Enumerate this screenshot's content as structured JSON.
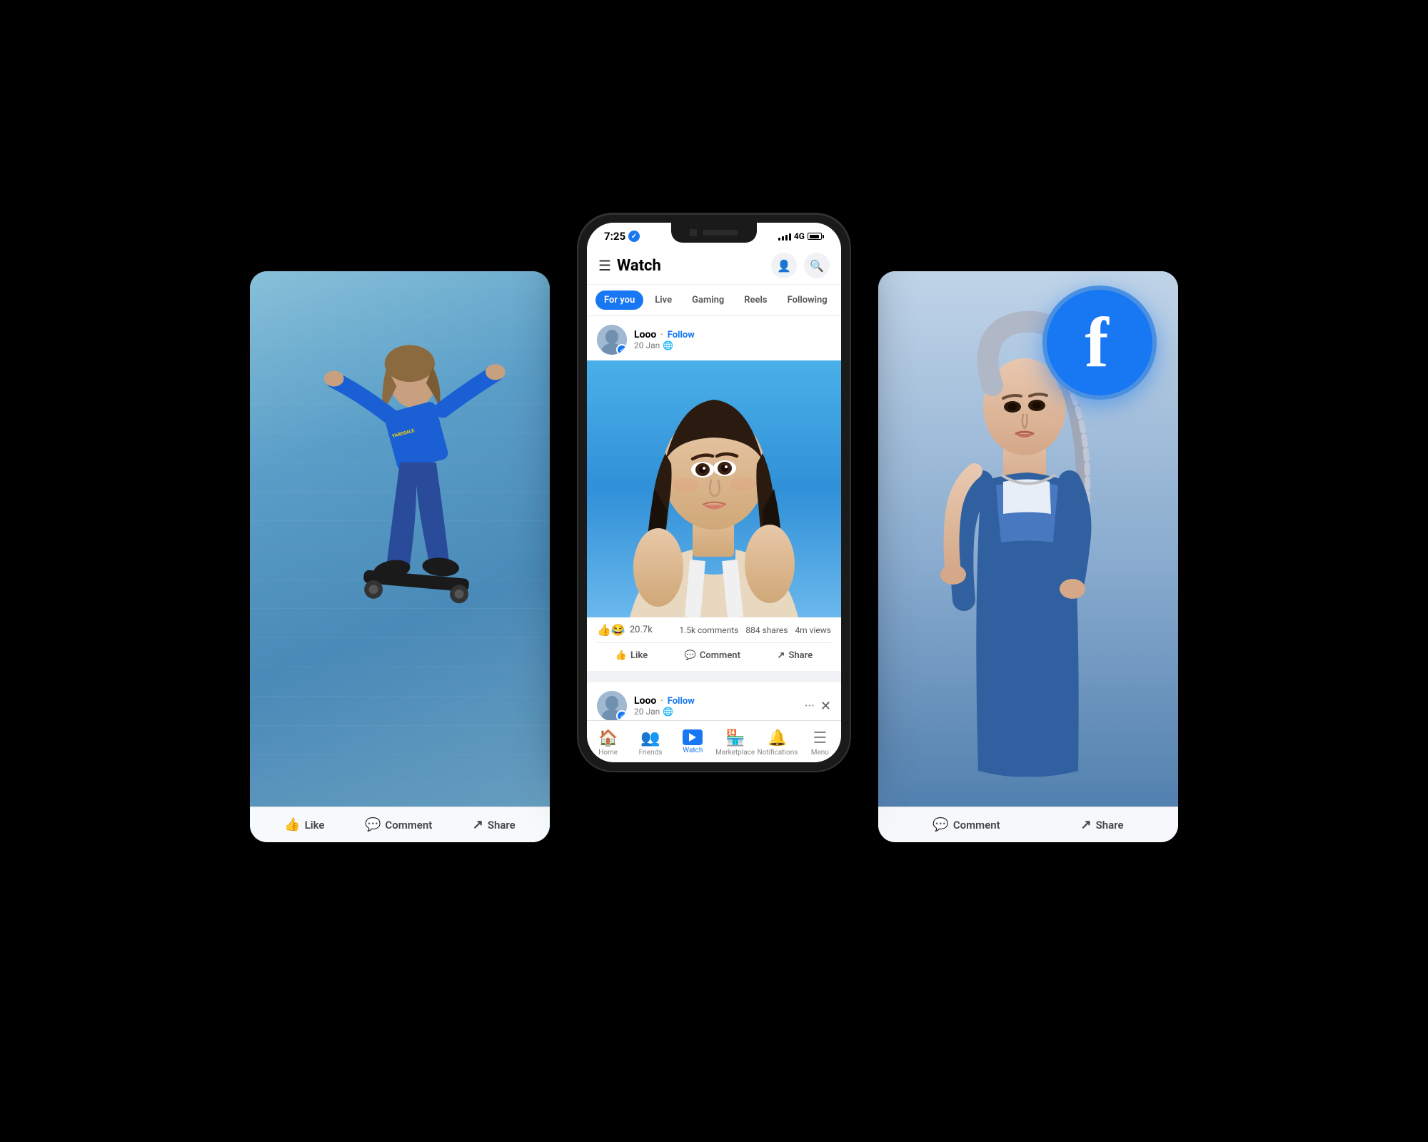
{
  "scene": {
    "background": "#000000"
  },
  "phone": {
    "status_bar": {
      "time": "7:25",
      "network": "4G",
      "fb_verified": "✓"
    },
    "header": {
      "menu_icon": "☰",
      "title": "Watch",
      "profile_icon": "👤",
      "search_icon": "🔍"
    },
    "tabs": [
      {
        "label": "For you",
        "active": true
      },
      {
        "label": "Live",
        "active": false
      },
      {
        "label": "Gaming",
        "active": false
      },
      {
        "label": "Reels",
        "active": false
      },
      {
        "label": "Following",
        "active": false
      }
    ],
    "post1": {
      "author": "Looo",
      "follow_label": "Follow",
      "date": "20 Jan",
      "globe_icon": "🌐",
      "reactions_count": "20.7k",
      "comments": "1.5k comments",
      "shares": "884 shares",
      "views": "4m views",
      "like_label": "Like",
      "comment_label": "Comment",
      "share_label": "Share"
    },
    "post2": {
      "author": "Looo",
      "follow_label": "Follow",
      "date": "20 Jan",
      "globe_icon": "🌐"
    },
    "bottom_nav": [
      {
        "label": "Home",
        "icon": "🏠",
        "active": false
      },
      {
        "label": "Friends",
        "icon": "👥",
        "active": false
      },
      {
        "label": "Watch",
        "icon": "watch",
        "active": true
      },
      {
        "label": "Marketplace",
        "icon": "🏪",
        "active": false
      },
      {
        "label": "Notifications",
        "icon": "🔔",
        "active": false
      },
      {
        "label": "Menu",
        "icon": "☰",
        "active": false
      }
    ]
  },
  "left_card": {
    "like_label": "Like",
    "comment_label": "Comment",
    "share_label": "Share"
  },
  "right_card": {
    "comment_label": "Comment",
    "share_label": "Share"
  },
  "fb_badge": {
    "letter": "f"
  }
}
